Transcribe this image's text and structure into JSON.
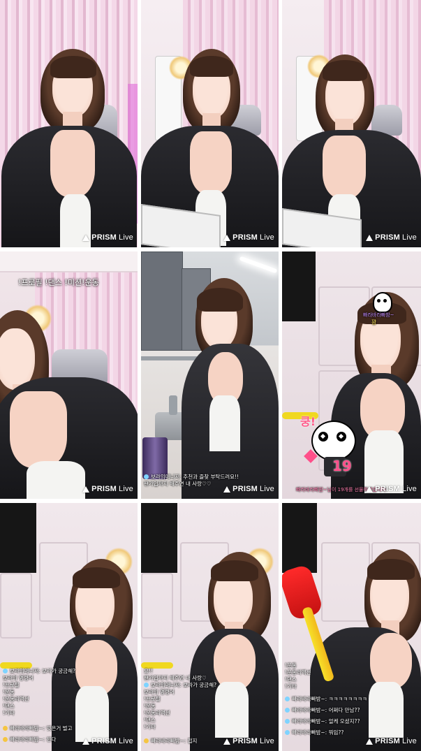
{
  "watermark": {
    "brand": "PRISM",
    "suffix": "Live"
  },
  "tiles": {
    "t4": {
      "banner": "!프로필 !댄스 !미션!운동"
    },
    "t5": {
      "chat": [
        {
          "text": "보라의매니저: 추천과 즐찾 부탁드려요!!",
          "dot": "#7fd3ff"
        },
        {
          "text": "팬가입까지 해주면 내 사랑♡♡",
          "dot": ""
        }
      ]
    },
    "t6": {
      "label_top": "빠라바라빠밤~",
      "label_top2": "꽝",
      "effect_word": "쿵!",
      "effect_number": "19",
      "footer": "빠라바라빠밤~님이 19개를 선물하셨습니다!"
    },
    "t7": {
      "chat": [
        {
          "text": "보라의매니저: 보라가 궁금해?",
          "dot": "#7fd3ff"
        },
        {
          "text": "보라의 명령어",
          "dot": ""
        },
        {
          "text": "!프로필",
          "dot": ""
        },
        {
          "text": "!운동",
          "dot": ""
        },
        {
          "text": "!운동리액션",
          "dot": ""
        },
        {
          "text": "!댄스",
          "dot": ""
        },
        {
          "text": "!기타",
          "dot": ""
        },
        {
          "text": "",
          "dot": ""
        },
        {
          "text": "빠라바라빠밤~: 벗은거 벌고",
          "dot": "#f5c542"
        },
        {
          "text": "",
          "dot": ""
        },
        {
          "text": "빠라바라빠밤~: 쩐다",
          "dot": "#f5c542"
        }
      ]
    },
    "t8": {
      "chat": [
        {
          "text": "요!!",
          "dot": ""
        },
        {
          "text": "팬가입까지 해주면 내 사랑♡",
          "dot": ""
        },
        {
          "text": "보라의매니저: 보라가 궁금해?",
          "dot": "#7fd3ff"
        },
        {
          "text": "보라의 명령어",
          "dot": ""
        },
        {
          "text": "!프로필",
          "dot": ""
        },
        {
          "text": "!운동",
          "dot": ""
        },
        {
          "text": "!운동리액션",
          "dot": ""
        },
        {
          "text": "!댄스",
          "dot": ""
        },
        {
          "text": "!기타",
          "dot": ""
        },
        {
          "text": "",
          "dot": ""
        },
        {
          "text": "빠라바라빠밤~: 접지",
          "dot": "#f5c542"
        }
      ]
    },
    "t9": {
      "chat": [
        {
          "text": "!운동",
          "dot": ""
        },
        {
          "text": "!운동리액션",
          "dot": ""
        },
        {
          "text": "!댄스",
          "dot": ""
        },
        {
          "text": "!기타",
          "dot": ""
        },
        {
          "text": "",
          "dot": ""
        },
        {
          "text": "빠라바라빠밤~: ㅋㅋㅋㅋㅋㅋㅋㅋ",
          "dot": "#7fd3ff"
        },
        {
          "text": "",
          "dot": ""
        },
        {
          "text": "빠라바라빠밤~: 어쩌다 만남??",
          "dot": "#7fd3ff"
        },
        {
          "text": "",
          "dot": ""
        },
        {
          "text": "빠라바라빠밤~: 얼케 오셨지??",
          "dot": "#7fd3ff"
        },
        {
          "text": "",
          "dot": ""
        },
        {
          "text": "빠라바라빠밤~: 뭐임??",
          "dot": "#7fd3ff"
        }
      ]
    }
  }
}
